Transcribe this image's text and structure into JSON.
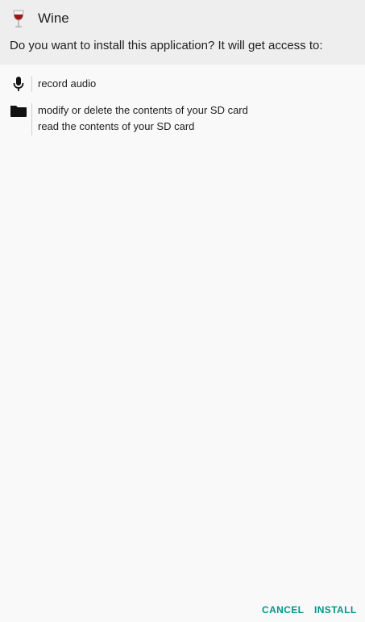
{
  "app": {
    "name": "Wine",
    "icon": "wine-glass-icon"
  },
  "dialog": {
    "question": "Do you want to install this application? It will get access to:"
  },
  "permissions": [
    {
      "icon": "microphone-icon",
      "items": [
        "record audio"
      ]
    },
    {
      "icon": "folder-icon",
      "items": [
        "modify or delete the contents of your SD card",
        "read the contents of your SD card"
      ]
    }
  ],
  "buttons": {
    "cancel": "CANCEL",
    "install": "INSTALL"
  },
  "colors": {
    "accent": "#009688",
    "header_bg": "#eeeeee",
    "body_bg": "#f9f9f9"
  }
}
